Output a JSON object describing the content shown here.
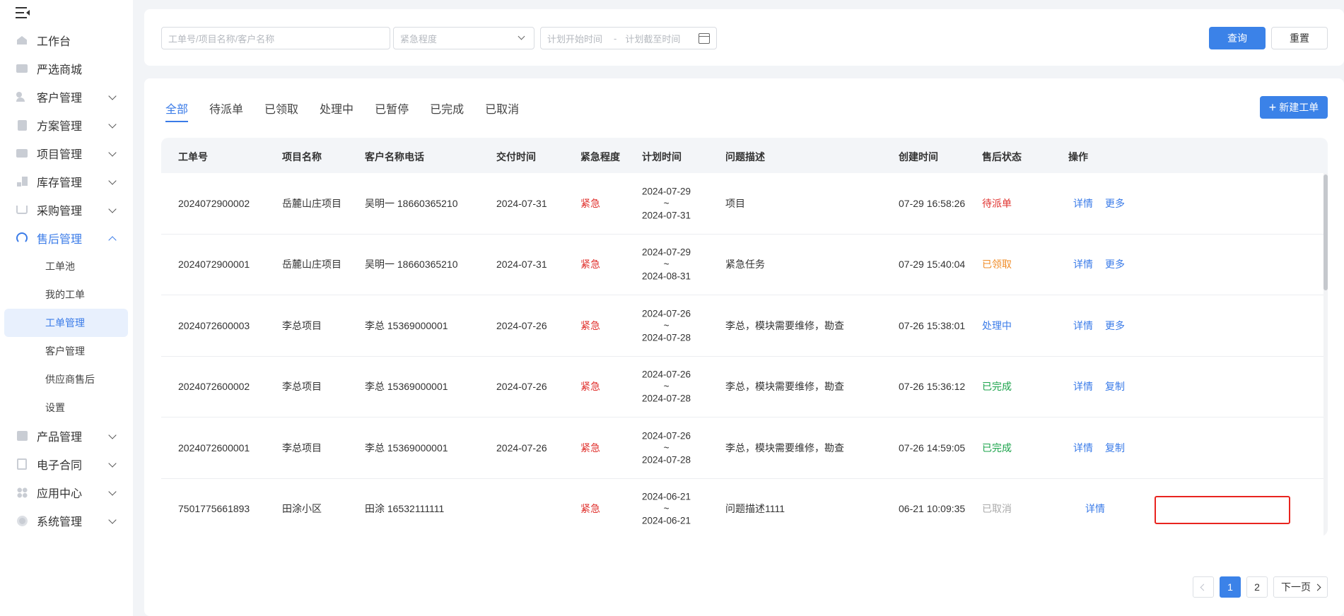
{
  "sidebar": {
    "menu": [
      {
        "label": "工作台",
        "icon": "home-icon",
        "expandable": false
      },
      {
        "label": "严选商城",
        "icon": "shop-icon",
        "expandable": false
      },
      {
        "label": "客户管理",
        "icon": "user-icon",
        "expandable": true
      },
      {
        "label": "方案管理",
        "icon": "document-icon",
        "expandable": true
      },
      {
        "label": "项目管理",
        "icon": "folder-icon",
        "expandable": true
      },
      {
        "label": "库存管理",
        "icon": "inventory-icon",
        "expandable": true
      },
      {
        "label": "采购管理",
        "icon": "cart-icon",
        "expandable": true
      },
      {
        "label": "售后管理",
        "icon": "headset-icon",
        "expandable": true,
        "expanded": true
      },
      {
        "label": "产品管理",
        "icon": "product-icon",
        "expandable": true
      },
      {
        "label": "电子合同",
        "icon": "contract-icon",
        "expandable": true
      },
      {
        "label": "应用中心",
        "icon": "apps-icon",
        "expandable": true
      },
      {
        "label": "系统管理",
        "icon": "settings-icon",
        "expandable": true
      }
    ],
    "aftersales_sub": [
      "工单池",
      "我的工单",
      "工单管理",
      "客户管理",
      "供应商售后",
      "设置"
    ],
    "active_sub": "工单管理"
  },
  "filter": {
    "keyword_placeholder": "工单号/项目名称/客户名称",
    "urgency_placeholder": "紧急程度",
    "plan_start_placeholder": "计划开始时间",
    "date_separator": "-",
    "plan_end_placeholder": "计划截至时间",
    "query_label": "查询",
    "reset_label": "重置"
  },
  "tabs": [
    "全部",
    "待派单",
    "已领取",
    "处理中",
    "已暂停",
    "已完成",
    "已取消"
  ],
  "active_tab": "全部",
  "new_ticket_label": "新建工单",
  "table": {
    "headers": [
      "工单号",
      "项目名称",
      "客户名称电话",
      "交付时间",
      "紧急程度",
      "计划时间",
      "问题描述",
      "创建时间",
      "售后状态",
      "操作"
    ],
    "rows": [
      {
        "id": "2024072900002",
        "project": "岳麓山庄项目",
        "customer": "吴明一  18660365210",
        "delivery": "2024-07-31",
        "urgency": "紧急",
        "plan_start": "2024-07-29",
        "plan_tilde": "~",
        "plan_end": "2024-07-31",
        "desc": "项目",
        "created": "07-29 16:58:26",
        "status": "待派单",
        "status_class": "st-pending",
        "op1": "详情",
        "op2": "更多"
      },
      {
        "id": "2024072900001",
        "project": "岳麓山庄项目",
        "customer": "吴明一  18660365210",
        "delivery": "2024-07-31",
        "urgency": "紧急",
        "plan_start": "2024-07-29",
        "plan_tilde": "~",
        "plan_end": "2024-08-31",
        "desc": "紧急任务",
        "created": "07-29 15:40:04",
        "status": "已领取",
        "status_class": "st-taken",
        "op1": "详情",
        "op2": "更多"
      },
      {
        "id": "2024072600003",
        "project": "李总项目",
        "customer": "李总  15369000001",
        "delivery": "2024-07-26",
        "urgency": "紧急",
        "plan_start": "2024-07-26",
        "plan_tilde": "~",
        "plan_end": "2024-07-28",
        "desc": "李总，模块需要维修，勘查",
        "created": "07-26 15:38:01",
        "status": "处理中",
        "status_class": "st-proc",
        "op1": "详情",
        "op2": "更多"
      },
      {
        "id": "2024072600002",
        "project": "李总项目",
        "customer": "李总  15369000001",
        "delivery": "2024-07-26",
        "urgency": "紧急",
        "plan_start": "2024-07-26",
        "plan_tilde": "~",
        "plan_end": "2024-07-28",
        "desc": "李总，模块需要维修，勘查",
        "created": "07-26 15:36:12",
        "status": "已完成",
        "status_class": "st-done",
        "op1": "详情",
        "op2": "复制"
      },
      {
        "id": "2024072600001",
        "project": "李总项目",
        "customer": "李总  15369000001",
        "delivery": "2024-07-26",
        "urgency": "紧急",
        "plan_start": "2024-07-26",
        "plan_tilde": "~",
        "plan_end": "2024-07-28",
        "desc": "李总，模块需要维修，勘查",
        "created": "07-26 14:59:05",
        "status": "已完成",
        "status_class": "st-done",
        "op1": "详情",
        "op2": "复制"
      },
      {
        "id": "7501775661893",
        "project": "田涂小区",
        "customer": "田涂  16532111111",
        "delivery": "",
        "urgency": "紧急",
        "plan_start": "2024-06-21",
        "plan_tilde": "~",
        "plan_end": "2024-06-21",
        "desc": "问题描述1111",
        "created": "06-21 10:09:35",
        "status": "已取消",
        "status_class": "st-cancel",
        "op1": "详情",
        "op2": ""
      }
    ]
  },
  "pagination": {
    "pages": [
      "1",
      "2"
    ],
    "current": "1",
    "next_label": "下一页"
  },
  "colors": {
    "primary": "#3b82e8",
    "urgent": "#e0322e",
    "highlight": "#e8241f"
  }
}
